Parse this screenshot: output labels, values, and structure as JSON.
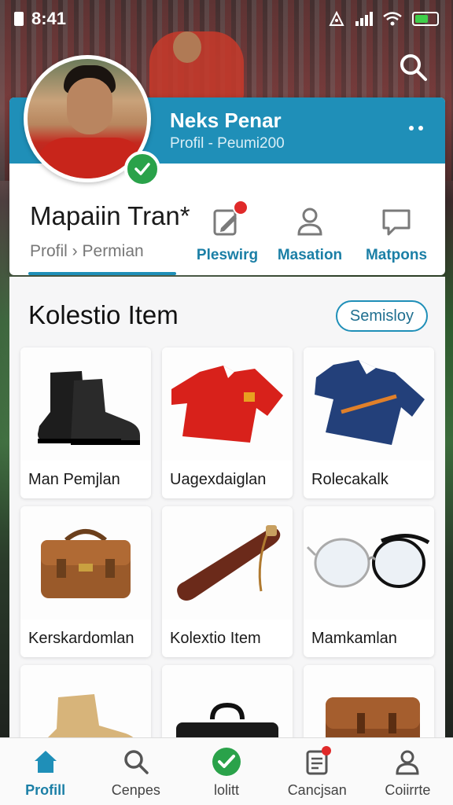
{
  "status_bar": {
    "time": "8:41"
  },
  "header": {
    "name": "Neks Penar",
    "subtitle": "Profil - Peumi200"
  },
  "profile": {
    "name": "Mapaiin Tran*",
    "breadcrumb": "Profil › Permian"
  },
  "actions": [
    {
      "label": "Pleswirg",
      "icon": "edit-note-icon",
      "badge": true
    },
    {
      "label": "Masation",
      "icon": "person-icon",
      "badge": false
    },
    {
      "label": "Matpons",
      "icon": "chat-bubble-icon",
      "badge": false
    }
  ],
  "collection": {
    "title": "Kolestio Item",
    "button": "Semisloy",
    "items": [
      {
        "caption": "Man Pemjlan",
        "image": "black-boots"
      },
      {
        "caption": "Uagexdaiglan",
        "image": "red-jersey"
      },
      {
        "caption": "Rolecakalk",
        "image": "blue-jersey"
      },
      {
        "caption": "Kerskardomlan",
        "image": "brown-leather-bag"
      },
      {
        "caption": "Kolextio Item",
        "image": "wooden-bat"
      },
      {
        "caption": "Mamkamlan",
        "image": "glasses"
      },
      {
        "caption": "",
        "image": "tan-boot"
      },
      {
        "caption": "",
        "image": "black-briefcase"
      },
      {
        "caption": "",
        "image": "brown-satchel"
      }
    ]
  },
  "bottom_nav": [
    {
      "label": "Profill",
      "icon": "home-icon",
      "active": true
    },
    {
      "label": "Cenpes",
      "icon": "search-icon",
      "active": false
    },
    {
      "label": "lolitt",
      "icon": "check-circle-icon",
      "active": false
    },
    {
      "label": "Cancjsan",
      "icon": "clipboard-icon",
      "active": false
    },
    {
      "label": "Coiirrte",
      "icon": "person-icon",
      "active": false
    }
  ],
  "colors": {
    "accent": "#1f8fb8",
    "success": "#2aa24a",
    "alert": "#e02a2a"
  }
}
